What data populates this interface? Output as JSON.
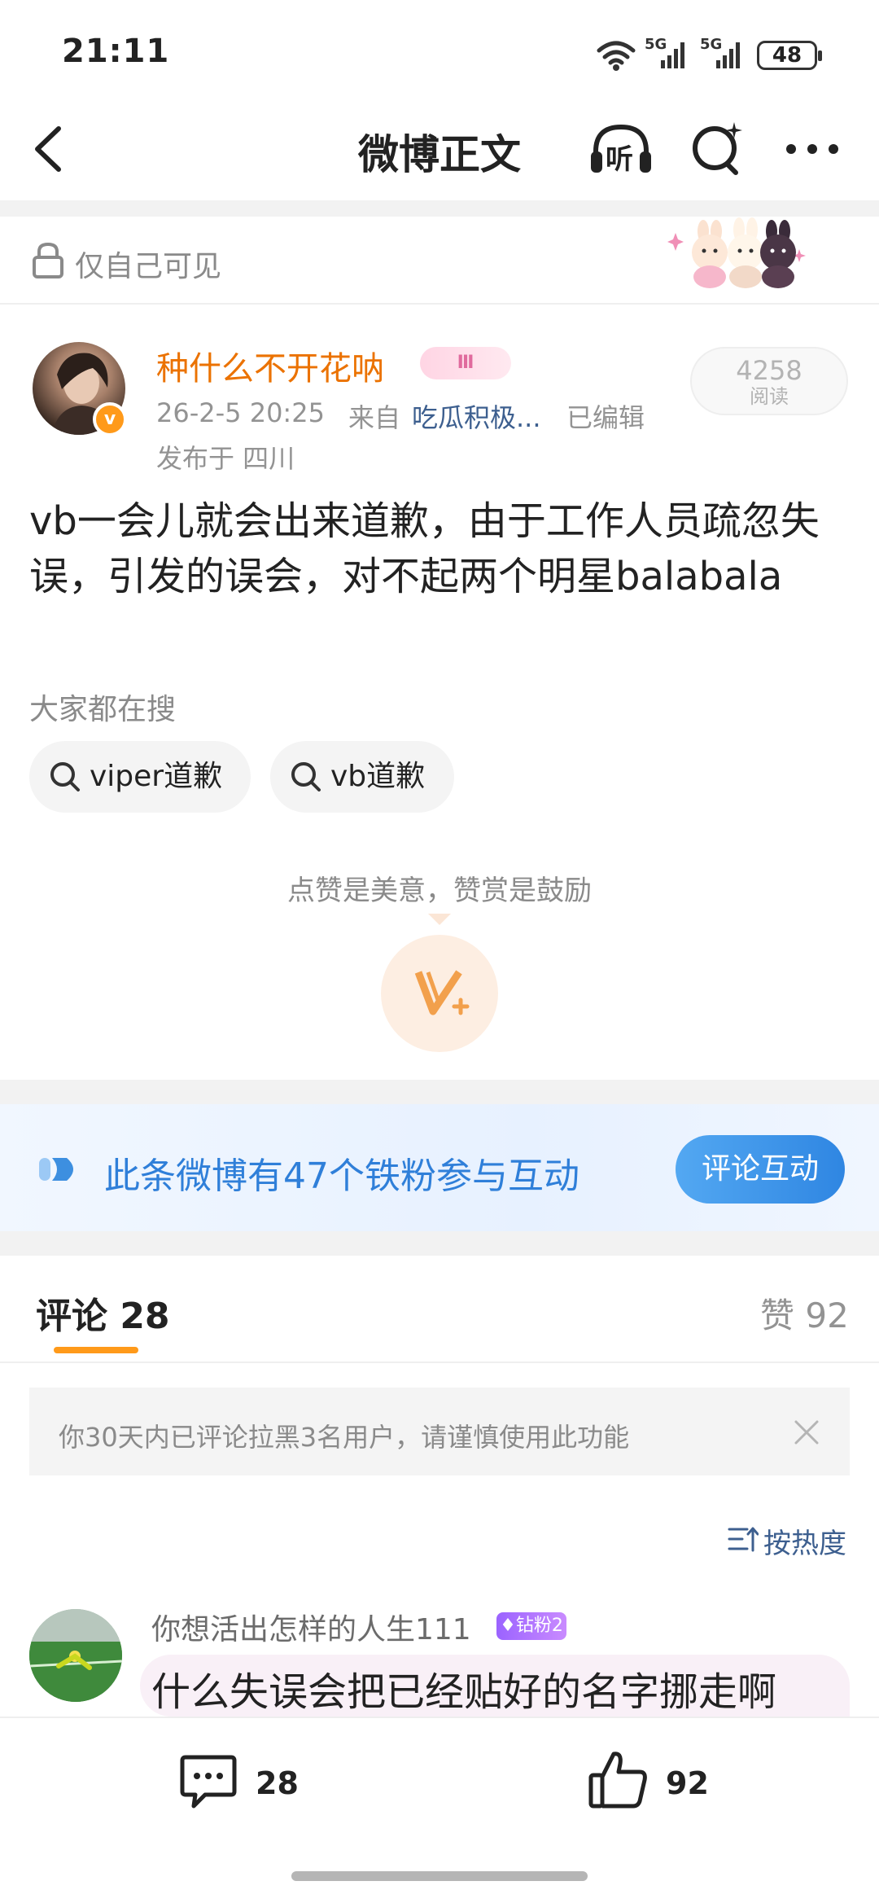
{
  "status_bar": {
    "time": "21:11",
    "network_1": "5G",
    "network_2": "5G",
    "battery": "48"
  },
  "nav": {
    "title": "微博正文",
    "listen_label": "听"
  },
  "post": {
    "visibility": "仅自己可见",
    "author": {
      "name": "种什么不开花呐",
      "verified_mark": "v",
      "level_badge": "Ⅲ"
    },
    "timestamp": "26-2-5 20:25",
    "source_prefix": "来自",
    "source": "吃瓜积极...",
    "edited": "已编辑",
    "location": "发布于 四川",
    "read_count": "4258",
    "read_label": "阅读",
    "text": "vb一会儿就会出来道歉，由于工作人员疏忽失误，引发的误会，对不起两个明星balabala",
    "trending_label": "大家都在搜",
    "trending": [
      "viper道歉",
      "vb道歉"
    ],
    "reward_text": "点赞是美意，赞赏是鼓励"
  },
  "fans_banner": {
    "text": "此条微博有47个铁粉参与互动",
    "button": "评论互动"
  },
  "comments": {
    "tab_label": "评论 28",
    "likes_label": "赞 92",
    "notice": "你30天内已评论拉黑3名用户，请谨慎使用此功能",
    "sort_label": "按热度",
    "items": [
      {
        "user": "你想活出怎样的人生111",
        "badge": "钻粉2",
        "text": "什么失误会把已经贴好的名字挪走啊"
      }
    ]
  },
  "bottom_bar": {
    "comment_count": "28",
    "like_count": "92"
  },
  "colors": {
    "accent_orange": "#ff9a1a",
    "author_orange": "#eb7200",
    "link_blue": "#2f7fd9"
  }
}
